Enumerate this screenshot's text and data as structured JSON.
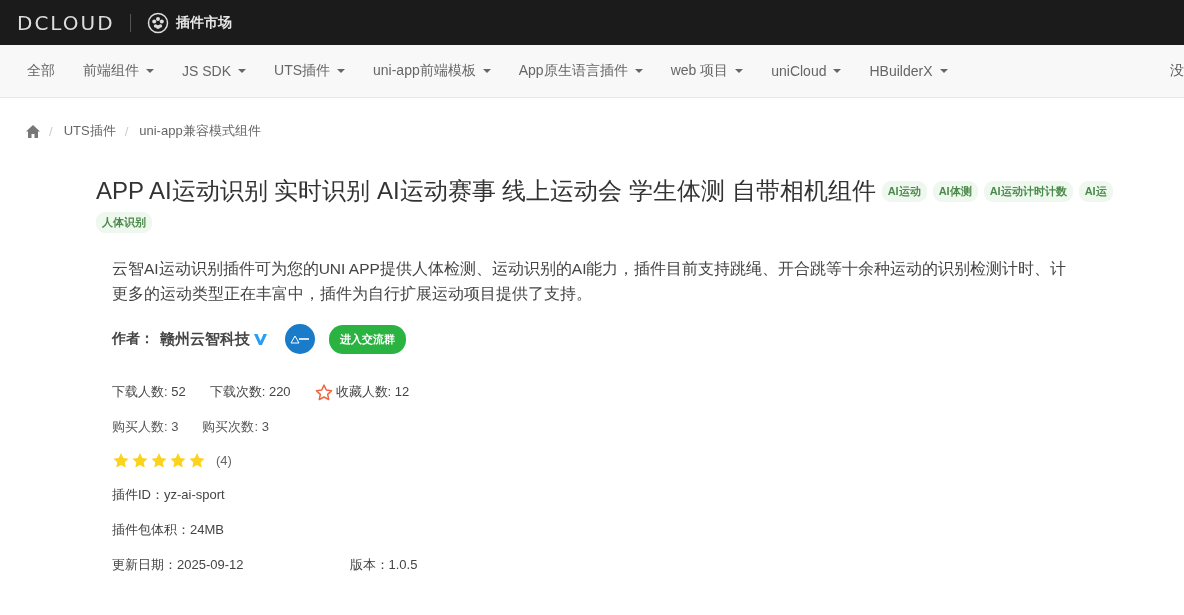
{
  "header": {
    "logo": "DCLOUD",
    "section": "插件市场"
  },
  "nav": [
    {
      "label": "全部",
      "dropdown": false
    },
    {
      "label": "前端组件",
      "dropdown": true
    },
    {
      "label": "JS SDK",
      "dropdown": true
    },
    {
      "label": "UTS插件",
      "dropdown": true
    },
    {
      "label": "uni-app前端模板",
      "dropdown": true
    },
    {
      "label": "App原生语言插件",
      "dropdown": true
    },
    {
      "label": "web 项目",
      "dropdown": true
    },
    {
      "label": "uniCloud",
      "dropdown": true
    },
    {
      "label": "HBuilderX",
      "dropdown": true
    }
  ],
  "nav_right": "没",
  "breadcrumb": [
    {
      "separator": "/",
      "label": "UTS插件"
    },
    {
      "separator": "/",
      "label": "uni-app兼容模式组件"
    }
  ],
  "title": "APP AI运动识别 实时识别 AI运动赛事 线上运动会 学生体测 自带相机组件",
  "tags": [
    "AI运动",
    "AI体测",
    "AI运动计时计数",
    "AI运"
  ],
  "tags_line2": [
    "人体识别"
  ],
  "description": [
    "云智AI运动识别插件可为您的UNI APP提供人体检测、运动识别的AI能力，插件目前支持跳绳、开合跳等十余种运动的识别检测计时、计",
    "更多的运动类型正在丰富中，插件为自行扩展运动项目提供了支持。"
  ],
  "author": {
    "label": "作者：",
    "name": "赣州云智科技",
    "verified": true,
    "button": "进入交流群"
  },
  "stats": [
    {
      "text": "下载人数: 52",
      "icon": false
    },
    {
      "text": "下载次数: 220",
      "icon": false
    },
    {
      "text": "收藏人数: 12",
      "icon": true
    }
  ],
  "purchases": [
    "购买人数: 3",
    "购买次数: 3"
  ],
  "rating": {
    "stars": 5,
    "count": "(4)"
  },
  "plugin_id": "插件ID：yz-ai-sport",
  "size": "插件包体积：24MB",
  "updated": "更新日期：2025-09-12",
  "version": "版本：1.0.5"
}
